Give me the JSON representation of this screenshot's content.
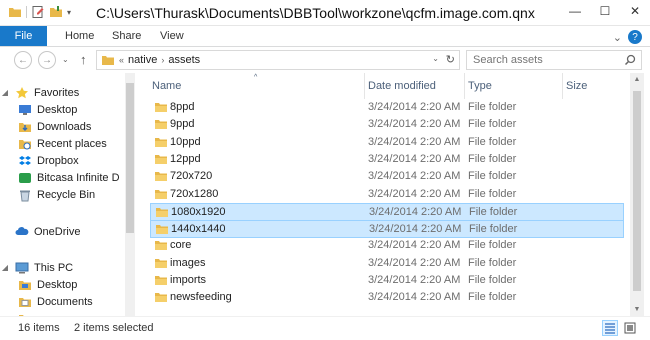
{
  "window": {
    "title": "C:\\Users\\Thurask\\Documents\\DBBTool\\workzone\\qcfm.image.com.qnx.coreos.qcfm...",
    "minimize_glyph": "—",
    "maximize_glyph": "☐",
    "close_glyph": "✕"
  },
  "ribbon": {
    "tabs": [
      "File",
      "Home",
      "Share",
      "View"
    ],
    "expand_glyph": "⌄",
    "help_glyph": "?"
  },
  "navigation": {
    "back_glyph": "←",
    "forward_glyph": "→",
    "recent_glyph": "⌄",
    "up_glyph": "↑",
    "path_prefix": "«",
    "path": [
      "native",
      "assets"
    ],
    "path_separator": "›",
    "dropdown_glyph": "⌄",
    "refresh_glyph": "↻",
    "search_placeholder": "Search assets"
  },
  "nav_pane": {
    "favorites_label": "Favorites",
    "favorites": [
      {
        "label": "Desktop",
        "icon": "desktop-icon"
      },
      {
        "label": "Downloads",
        "icon": "downloads-icon"
      },
      {
        "label": "Recent places",
        "icon": "recent-places-icon"
      },
      {
        "label": "Dropbox",
        "icon": "dropbox-icon"
      },
      {
        "label": "Bitcasa Infinite D",
        "icon": "bitcasa-icon"
      },
      {
        "label": "Recycle Bin",
        "icon": "recycle-bin-icon"
      }
    ],
    "onedrive_label": "OneDrive",
    "thispc_label": "This PC",
    "thispc_items": [
      {
        "label": "Desktop",
        "icon": "desktop-icon"
      },
      {
        "label": "Documents",
        "icon": "documents-icon"
      }
    ]
  },
  "columns": {
    "name": "Name",
    "date": "Date modified",
    "type": "Type",
    "size": "Size",
    "sort_glyph": "^"
  },
  "files": [
    {
      "name": "8ppd",
      "date": "3/24/2014 2:20 AM",
      "type": "File folder",
      "selected": false
    },
    {
      "name": "9ppd",
      "date": "3/24/2014 2:20 AM",
      "type": "File folder",
      "selected": false
    },
    {
      "name": "10ppd",
      "date": "3/24/2014 2:20 AM",
      "type": "File folder",
      "selected": false
    },
    {
      "name": "12ppd",
      "date": "3/24/2014 2:20 AM",
      "type": "File folder",
      "selected": false
    },
    {
      "name": "720x720",
      "date": "3/24/2014 2:20 AM",
      "type": "File folder",
      "selected": false
    },
    {
      "name": "720x1280",
      "date": "3/24/2014 2:20 AM",
      "type": "File folder",
      "selected": false
    },
    {
      "name": "1080x1920",
      "date": "3/24/2014 2:20 AM",
      "type": "File folder",
      "selected": true
    },
    {
      "name": "1440x1440",
      "date": "3/24/2014 2:20 AM",
      "type": "File folder",
      "selected": true
    },
    {
      "name": "core",
      "date": "3/24/2014 2:20 AM",
      "type": "File folder",
      "selected": false
    },
    {
      "name": "images",
      "date": "3/24/2014 2:20 AM",
      "type": "File folder",
      "selected": false
    },
    {
      "name": "imports",
      "date": "3/24/2014 2:20 AM",
      "type": "File folder",
      "selected": false
    },
    {
      "name": "newsfeeding",
      "date": "3/24/2014 2:20 AM",
      "type": "File folder",
      "selected": false
    }
  ],
  "status": {
    "item_count": "16 items",
    "selection": "2 items selected"
  },
  "colors": {
    "file_tab": "#1979ca",
    "selection_bg": "#cce8ff",
    "selection_border": "#99d1ff",
    "folder": "#e8b84a",
    "column_header_text": "#4c607a"
  }
}
